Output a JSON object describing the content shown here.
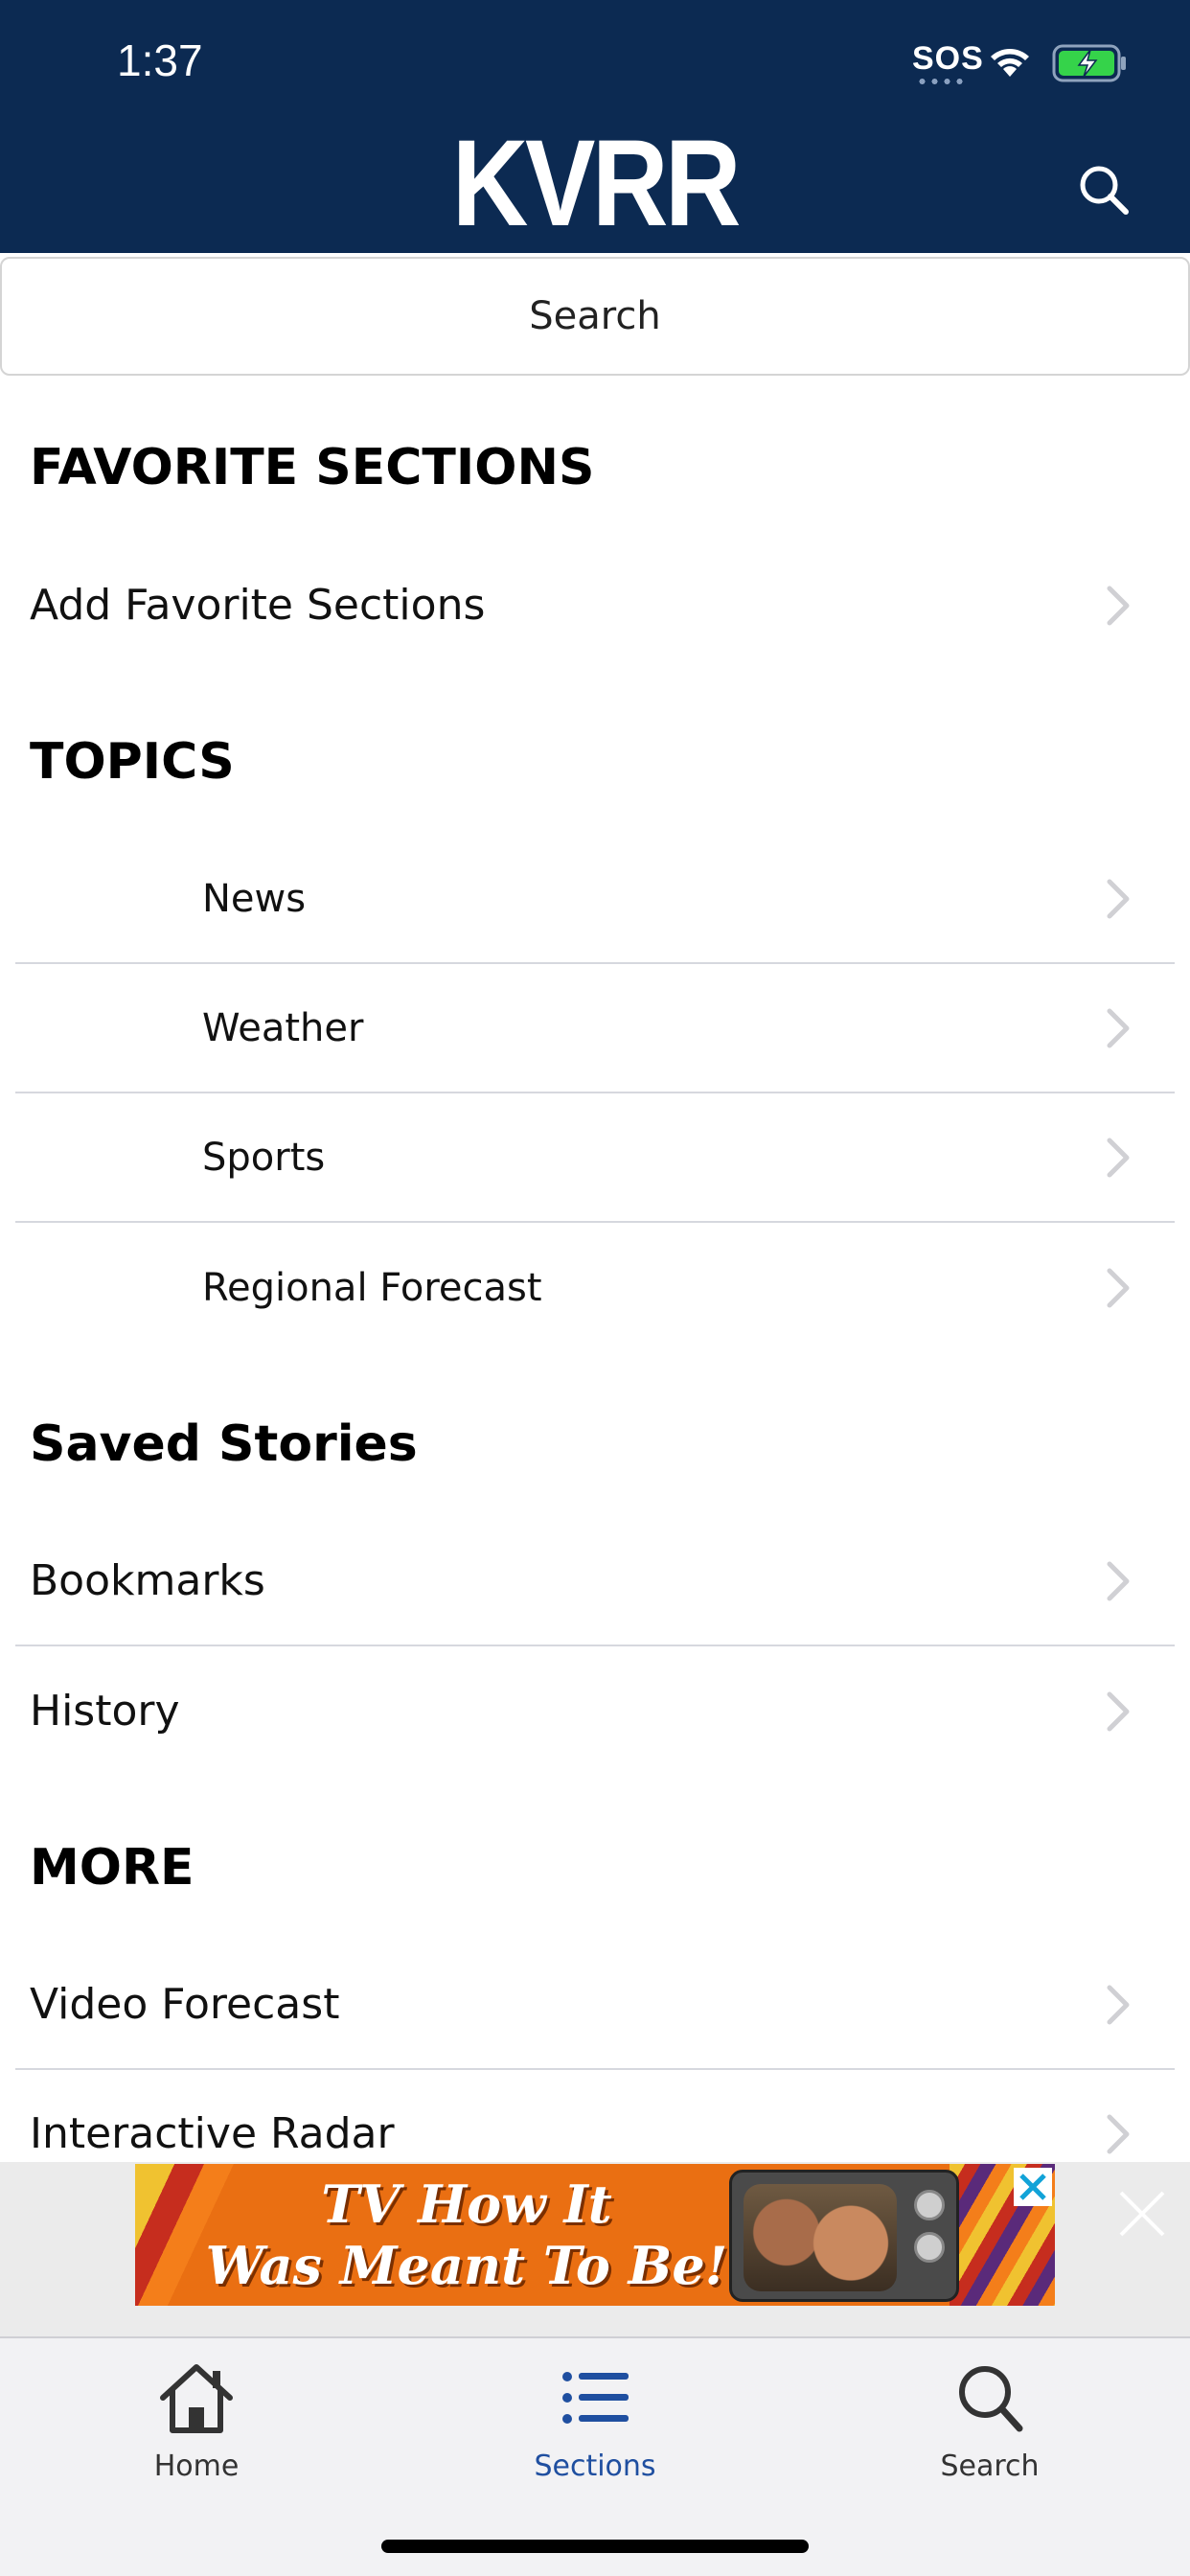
{
  "status_bar": {
    "time": "1:37",
    "sos": "SOS"
  },
  "header": {
    "logo": "KVRR",
    "search_icon": "search-icon"
  },
  "search": {
    "label": "Search"
  },
  "sections": [
    {
      "title": "FAVORITE SECTIONS",
      "items": [
        {
          "label": "Add Favorite Sections"
        }
      ]
    },
    {
      "title": "TOPICS",
      "items": [
        {
          "label": "News"
        },
        {
          "label": "Weather"
        },
        {
          "label": "Sports"
        },
        {
          "label": "Regional Forecast"
        }
      ]
    },
    {
      "title": "Saved Stories",
      "items": [
        {
          "label": "Bookmarks"
        },
        {
          "label": "History"
        }
      ]
    },
    {
      "title": "MORE",
      "items": [
        {
          "label": "Video Forecast"
        },
        {
          "label": "Interactive Radar"
        }
      ]
    }
  ],
  "ad": {
    "line1": "TV How It",
    "line2": "Was Meant To Be!"
  },
  "tabbar": {
    "home": {
      "label": "Home",
      "icon": "home-icon"
    },
    "sections": {
      "label": "Sections",
      "icon": "list-icon",
      "active": true
    },
    "search": {
      "label": "Search",
      "icon": "search-icon"
    }
  },
  "colors": {
    "header_bg": "#0c2a52",
    "active_tab": "#1f4fa0",
    "ad_orange": "#ea6f12"
  }
}
